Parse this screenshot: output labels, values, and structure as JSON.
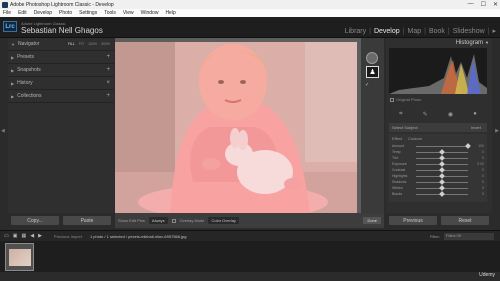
{
  "window": {
    "title": "Adobe Photoshop Lightroom Classic - Develop",
    "controls": [
      "—",
      "☐",
      "✕"
    ]
  },
  "menu": [
    "File",
    "Edit",
    "Develop",
    "Photo",
    "Settings",
    "Tools",
    "View",
    "Window",
    "Help"
  ],
  "identity": {
    "logo": "Lrc",
    "app_line": "Adobe Lightroom Classic",
    "user_name": "Sebastian Nell Ghagos"
  },
  "modules": [
    "Library",
    "Develop",
    "Map",
    "Book",
    "Slideshow"
  ],
  "left_panel": {
    "navigator": {
      "label": "Navigator",
      "zoom_options": [
        "FILL",
        "FIT",
        "100%",
        "300%"
      ]
    },
    "sections": [
      "Presets",
      "Snapshots",
      "History",
      "Collections"
    ],
    "buttons": [
      "Copy...",
      "Paste"
    ]
  },
  "toolbar": {
    "show_edit_pins": "Show Edit Pins",
    "pins_value": "Always",
    "overlay_mode": "Overlay Mode",
    "overlay_value": "Color Overlay",
    "done": "Done"
  },
  "right_panel": {
    "histogram_label": "Histogram",
    "original_photo": "Original Photo",
    "select_subject": "Select Subject",
    "invert": "Invert",
    "mask_top": [
      "Effect",
      "Custom"
    ],
    "sliders": [
      {
        "label": "Amount",
        "val": "100"
      },
      {
        "label": "Temp",
        "val": "0"
      },
      {
        "label": "Tint",
        "val": "0"
      },
      {
        "label": "Exposure",
        "val": "0.00"
      },
      {
        "label": "Contrast",
        "val": "0"
      },
      {
        "label": "Highlights",
        "val": "0"
      },
      {
        "label": "Shadows",
        "val": "0"
      },
      {
        "label": "Whites",
        "val": "0"
      },
      {
        "label": "Blacks",
        "val": "0"
      }
    ],
    "buttons": [
      "Previous",
      "Reset"
    ]
  },
  "filmstrip_bar": {
    "source": "Previous Import",
    "path": "1 photo / 1 selected / pexels-mikhail-nilov-6957566.jpg",
    "filter_label": "Filter:",
    "filter_value": "Filters Off"
  },
  "watermark": "Udemy",
  "colors": {
    "accent": "#7fb8ef",
    "mask_overlay": "#ff8a8a"
  }
}
